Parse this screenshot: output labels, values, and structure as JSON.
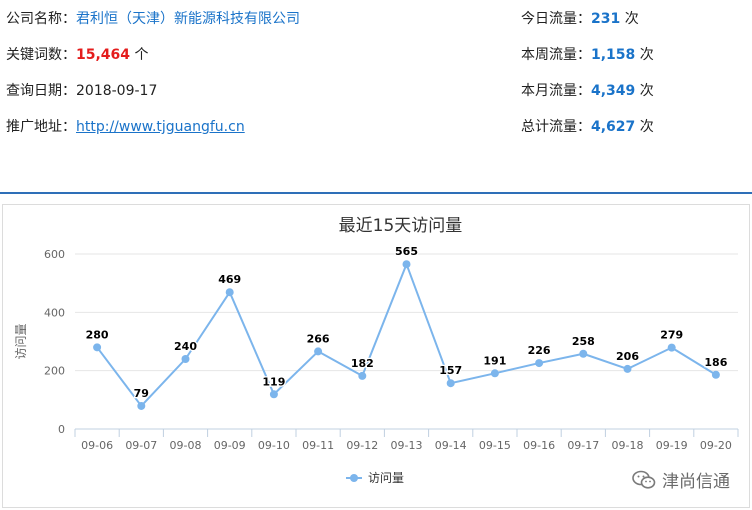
{
  "company": {
    "label": "公司名称：",
    "value": "君利恒（天津）新能源科技有限公司"
  },
  "keywords": {
    "label": "关键词数：",
    "value": "15,464",
    "unit": "个"
  },
  "query_date": {
    "label": "查询日期：",
    "value": "2018-09-17"
  },
  "promo": {
    "label": "推广地址：",
    "value": "http://www.tjguangfu.cn"
  },
  "traffic": {
    "today": {
      "label": "今日流量：",
      "value": "231",
      "unit": "次"
    },
    "week": {
      "label": "本周流量：",
      "value": "1,158",
      "unit": "次"
    },
    "month": {
      "label": "本月流量：",
      "value": "4,349",
      "unit": "次"
    },
    "total": {
      "label": "总计流量：",
      "value": "4,627",
      "unit": "次"
    }
  },
  "colors": {
    "link": "#1a73c9",
    "red": "#e41c1c",
    "line": "#7cb5ec",
    "divider": "#2e6fb8"
  },
  "watermark": {
    "icon": "wechat-icon",
    "text": "津尚信通"
  },
  "chart_data": {
    "type": "line",
    "title": "最近15天访问量",
    "ylabel": "访问量",
    "xlabel": "",
    "ylim": [
      0,
      600
    ],
    "yticks": [
      0,
      200,
      400,
      600
    ],
    "grid": true,
    "legend_position": "bottom-center",
    "categories": [
      "09-06",
      "09-07",
      "09-08",
      "09-09",
      "09-10",
      "09-11",
      "09-12",
      "09-13",
      "09-14",
      "09-15",
      "09-16",
      "09-17",
      "09-18",
      "09-19",
      "09-20"
    ],
    "series": [
      {
        "name": "访问量",
        "values": [
          280,
          79,
          240,
          469,
          119,
          266,
          182,
          565,
          157,
          191,
          226,
          258,
          206,
          279,
          186
        ]
      }
    ]
  }
}
